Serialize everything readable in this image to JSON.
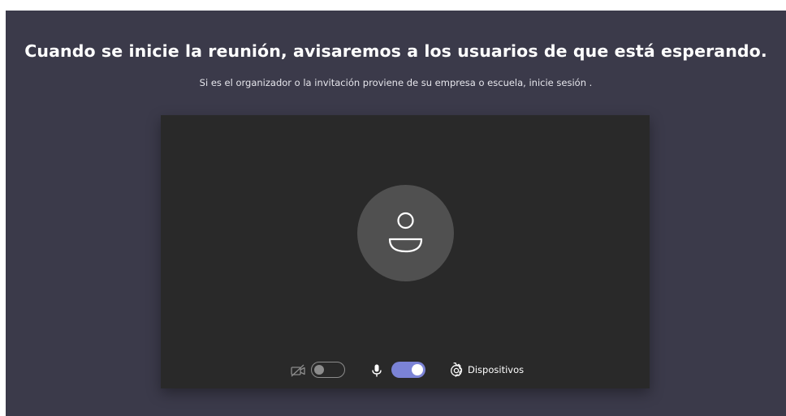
{
  "prejoin": {
    "title": "Cuando se inicie la reunión, avisaremos a los usuarios de que está esperando.",
    "subtitle": "Si es el organizador o la invitación proviene de su empresa o escuela, inicie sesión ."
  },
  "controls": {
    "camera": {
      "icon": "camera-off-icon",
      "enabled": false
    },
    "microphone": {
      "icon": "microphone-icon",
      "enabled": true
    },
    "devices": {
      "icon": "gear-icon",
      "label": "Dispositivos"
    }
  },
  "colors": {
    "background": "#3b3a4a",
    "preview": "#292929",
    "avatar": "#505050",
    "accent": "#7b83d6"
  }
}
